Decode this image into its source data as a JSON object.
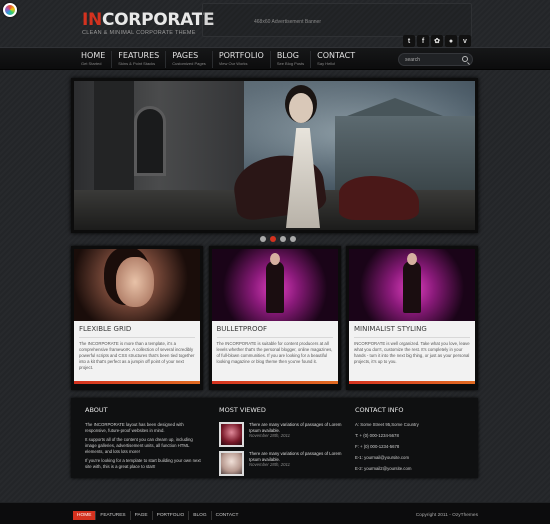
{
  "header": {
    "logo_accent": "IN",
    "logo_rest": "CORPORATE",
    "tagline": "CLEAN & MINIMAL CORPORATE THEME",
    "ad_banner": "468x60 Advertisement Banner",
    "social_icons": [
      "twitter-icon",
      "facebook-icon",
      "flickr-icon",
      "location-icon",
      "vimeo-icon"
    ]
  },
  "nav": {
    "items": [
      {
        "label": "HOME",
        "sub": "Get Started"
      },
      {
        "label": "FEATURES",
        "sub": "Skins & Point Stacks"
      },
      {
        "label": "PAGES",
        "sub": "Customized Pages"
      },
      {
        "label": "PORTFOLIO",
        "sub": "View Our Works"
      },
      {
        "label": "BLOG",
        "sub": "See Blog Posts"
      },
      {
        "label": "CONTACT",
        "sub": "Say Hello!"
      }
    ],
    "search_placeholder": "search"
  },
  "slider": {
    "slide_count": 4,
    "active_index": 1
  },
  "features": [
    {
      "title": "FLEXIBLE GRID",
      "text": "The INCORPORATE is more than a template, it's a comprehensive frameworK. A collection of several incredibly powerful scripts and CSS structures that's been tied together into a kit that's perfect as a jumpin off point of your next project."
    },
    {
      "title": "BULLETPROOF",
      "text": "The INCORPORATE is suitable for content producers at all levels whether that's the personal blogger, online magazines, of full-blown communities. If you are looking for a beautiful looking magazine or blog theme then you've found it."
    },
    {
      "title": "MINIMALIST STYLING",
      "text": "INCORPORATE is well organized. Take what you love, leave what you don't, customize the rest. It's completely in your hands - turn it into the next big thing, or just as your personal projects, it's up to you."
    }
  ],
  "about": {
    "heading": "ABOUT",
    "paragraphs": [
      "The INCORPORATE layout has been designed with responsive, future-proof websites in mind.",
      "It supports all of the content you can dream up, including image galleries, advertisement units, all function HTML elements, and lots lots more!",
      "If you're looking for a template to start building your own next site with, this is a great place to start!"
    ]
  },
  "most_viewed": {
    "heading": "MOST VIEWED",
    "items": [
      {
        "title": "There are many variations of passages of Lorem Ipsum available.",
        "date": "November 28th, 2011"
      },
      {
        "title": "There are many variations of passages of Lorem Ipsum available.",
        "date": "November 28th, 2011"
      }
    ]
  },
  "contact": {
    "heading": "CONTACT INFO",
    "lines": [
      "A: Some Street 95,Some Country",
      "T: + (0) 000-1234-5678",
      "F: + (0) 000-1234-5678",
      "E-1: yourmail@yoursite.com",
      "E-2: yourmail2@yoursite.com"
    ]
  },
  "footer": {
    "nav": [
      "HOME",
      "FEATURES",
      "PAGE",
      "PORTFOLIO",
      "BLOG",
      "CONTACT"
    ],
    "active": "HOME",
    "copyright": "Copyright 2011 - OzyThemes"
  },
  "colors": {
    "accent": "#d4321f",
    "background": "#232528",
    "card_body": "#f2f2f2"
  }
}
